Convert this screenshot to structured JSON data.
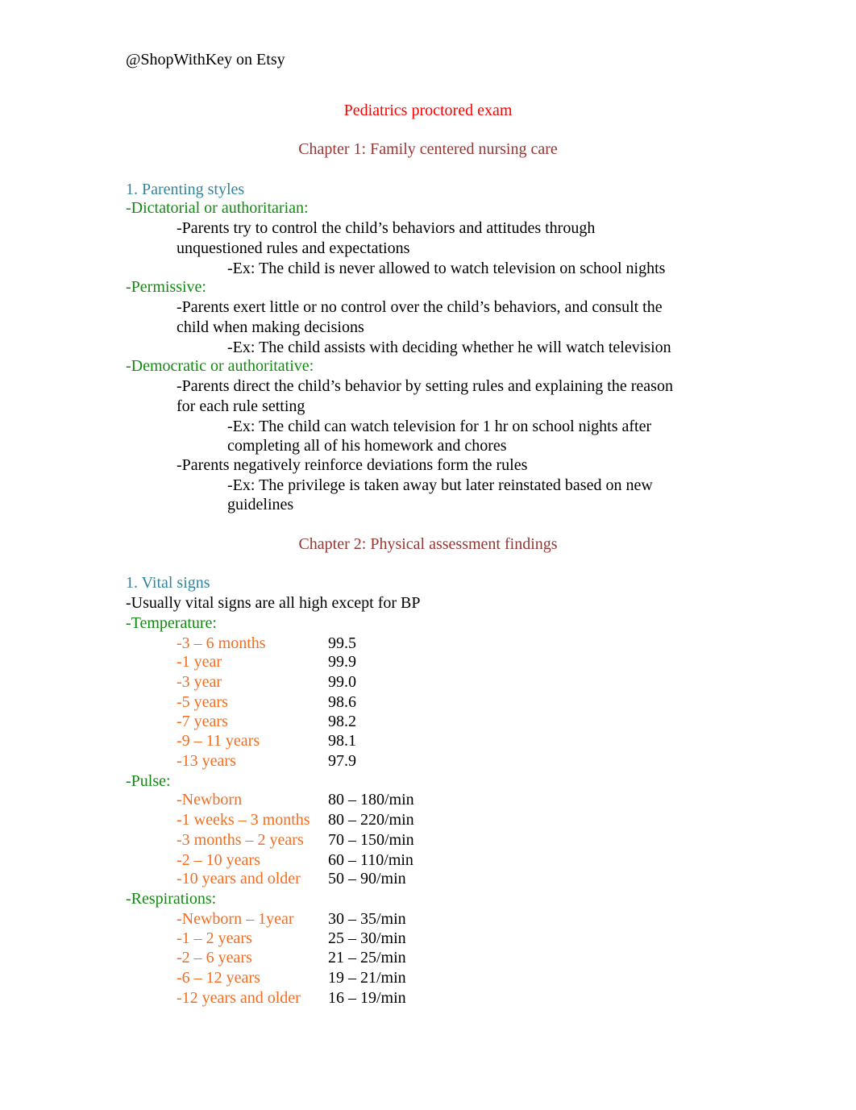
{
  "credit": "@ShopWithKey on Etsy",
  "title": "Pediatrics proctored exam",
  "chapter1": {
    "heading": "Chapter 1: Family centered nursing care",
    "section": "1. Parenting styles",
    "styles": [
      {
        "name": "-Dictatorial or authoritarian:",
        "desc_lines": [
          "-Parents try to control the child’s behaviors and attitudes through",
          "unquestioned rules and expectations"
        ],
        "example_lines": [
          "-Ex: The child is never allowed to watch television on school nights"
        ]
      },
      {
        "name": "-Permissive:",
        "desc_lines": [
          "-Parents exert little or no control over the child’s behaviors, and consult the",
          "child when making decisions"
        ],
        "example_lines": [
          "-Ex: The child assists with deciding whether he will watch television"
        ]
      },
      {
        "name": "-Democratic or authoritative:",
        "desc_lines": [
          "-Parents direct the child’s behavior by setting rules and explaining the reason",
          "for each rule setting"
        ],
        "example_lines": [
          "-Ex: The child can watch television for 1 hr on school nights after",
          "completing all of his homework and chores"
        ],
        "desc2_lines": [
          "-Parents negatively reinforce deviations form the rules"
        ],
        "example2_lines": [
          "-Ex: The privilege is taken away but later reinstated based on new",
          "guidelines"
        ]
      }
    ]
  },
  "chapter2": {
    "heading": "Chapter 2: Physical assessment findings",
    "section": "1. Vital signs",
    "note": "-Usually vital signs are all high except for BP",
    "temperature": {
      "label": "-Temperature:",
      "rows": [
        {
          "age": "-3 – 6 months",
          "value": "99.5"
        },
        {
          "age": "-1 year",
          "value": "99.9"
        },
        {
          "age": "-3 year",
          "value": "99.0"
        },
        {
          "age": "-5 years",
          "value": "98.6"
        },
        {
          "age": "-7 years",
          "value": "98.2"
        },
        {
          "age": "-9 – 11 years",
          "value": "98.1"
        },
        {
          "age": "-13 years",
          "value": "97.9"
        }
      ]
    },
    "pulse": {
      "label": "-Pulse:",
      "rows": [
        {
          "age": "-Newborn",
          "value": "80 – 180/min"
        },
        {
          "age": "-1 weeks – 3 months",
          "value": "80 – 220/min"
        },
        {
          "age": "-3 months – 2 years",
          "value": "70 – 150/min"
        },
        {
          "age": "-2 – 10 years",
          "value": "60 – 110/min"
        },
        {
          "age": "-10 years and older",
          "value": "50 – 90/min"
        }
      ]
    },
    "respirations": {
      "label": "-Respirations:",
      "rows": [
        {
          "age": "-Newborn – 1year",
          "value": "30 – 35/min"
        },
        {
          "age": "-1 – 2 years",
          "value": "25 – 30/min"
        },
        {
          "age": "-2 – 6 years",
          "value": "21 – 25/min"
        },
        {
          "age": "-6 – 12 years",
          "value": "19 – 21/min"
        },
        {
          "age": "-12 years and older",
          "value": "16 – 19/min"
        }
      ]
    }
  }
}
